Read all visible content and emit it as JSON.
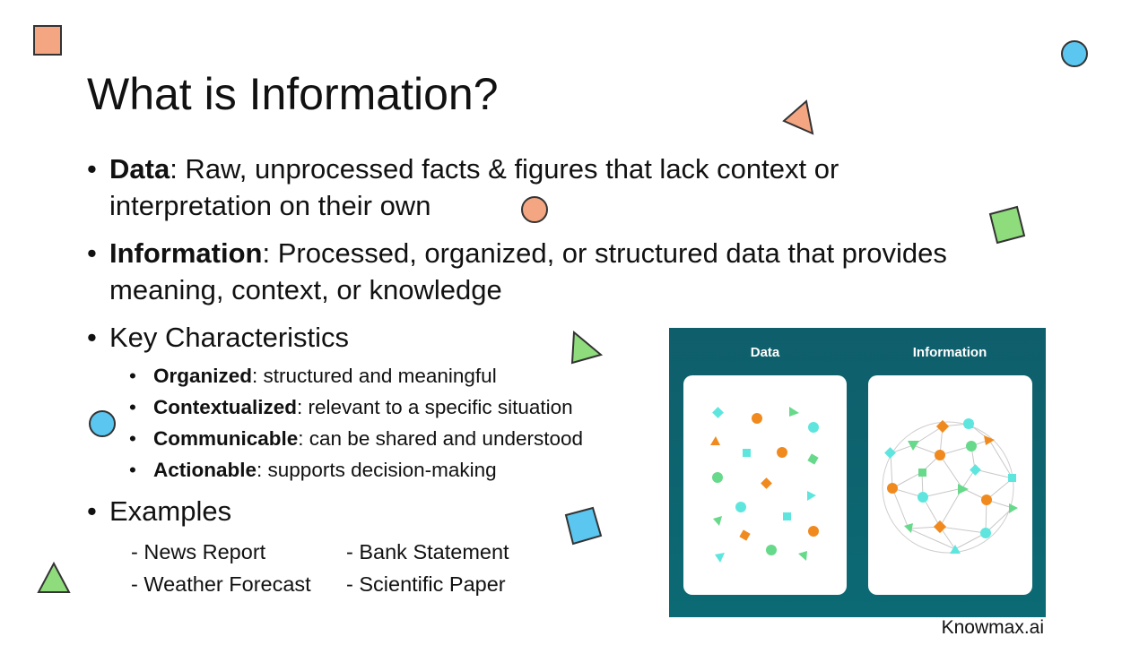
{
  "slide": {
    "title": "What is Information?",
    "bullets": [
      {
        "term": "Data",
        "text": ": Raw, unprocessed facts & figures that lack context or interpretation on their own"
      },
      {
        "term": "Information",
        "text": ": Processed, organized, or structured data that provides meaning, context, or knowledge"
      }
    ],
    "characteristics": {
      "heading": "Key Characteristics",
      "items": [
        {
          "term": "Organized",
          "text": ": structured and meaningful"
        },
        {
          "term": "Contextualized",
          "text": ": relevant to a specific situation"
        },
        {
          "term": "Communicable",
          "text": ": can be shared and understood"
        },
        {
          "term": "Actionable",
          "text": ": supports decision-making"
        }
      ]
    },
    "examples": {
      "heading": "Examples",
      "items": [
        "- News Report",
        "- Bank Statement",
        "- Weather Forecast",
        "- Scientific Paper"
      ]
    },
    "credit": "Knowmax.ai"
  },
  "infographic": {
    "left_label": "Data",
    "right_label": "Information",
    "colors": {
      "background": "#0f5e6b",
      "orange": "#f08a1e",
      "cyan": "#5ee6de",
      "green": "#67d98a"
    }
  },
  "decorations": {
    "colors": {
      "salmon": "#f4a582",
      "blue": "#5bc6f0",
      "green": "#8fdc7c",
      "stroke": "#333333"
    }
  }
}
